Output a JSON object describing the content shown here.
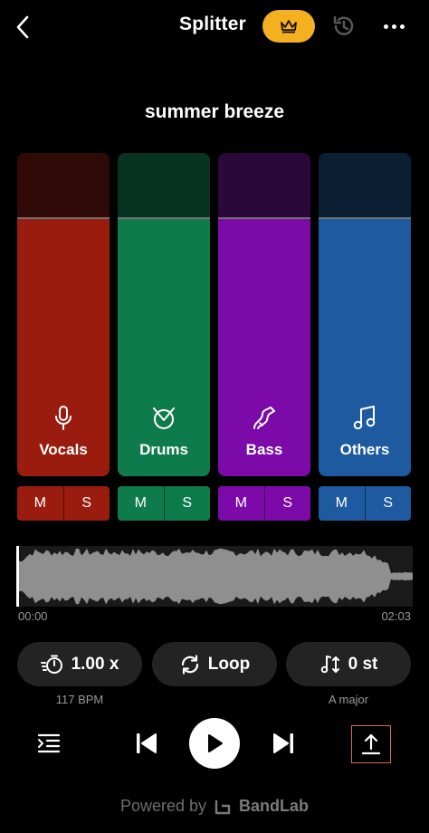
{
  "header": {
    "title": "Splitter",
    "back_icon": "chevron-left-icon",
    "premium_icon": "crown-icon",
    "history_icon": "history-icon",
    "more_icon": "more-dots-icon",
    "accent_color": "#f5b020"
  },
  "song": {
    "title": "summer breeze"
  },
  "stems": [
    {
      "label": "Vocals",
      "icon": "microphone-icon",
      "color": "#9a1c0e",
      "top_color": "#2f0a06",
      "mute": "M",
      "solo": "S"
    },
    {
      "label": "Drums",
      "icon": "drum-icon",
      "color": "#0e7b4c",
      "top_color": "#063322",
      "mute": "M",
      "solo": "S"
    },
    {
      "label": "Bass",
      "icon": "guitar-icon",
      "color": "#7b0aa9",
      "top_color": "#2a0839",
      "mute": "M",
      "solo": "S"
    },
    {
      "label": "Others",
      "icon": "music-note-icon",
      "color": "#1e5aa0",
      "top_color": "#0a1f33",
      "mute": "M",
      "solo": "S"
    }
  ],
  "timeline": {
    "start": "00:00",
    "end": "02:03"
  },
  "controls": {
    "speed": {
      "label": "1.00 x",
      "sub": "117 BPM",
      "icon": "tempo-icon"
    },
    "loop": {
      "label": "Loop",
      "icon": "loop-icon"
    },
    "pitch": {
      "label": "0 st",
      "sub": "A major",
      "icon": "pitch-icon"
    }
  },
  "transport": {
    "list_icon": "track-list-icon",
    "prev_icon": "skip-previous-icon",
    "play_icon": "play-icon",
    "next_icon": "skip-next-icon",
    "export_icon": "export-icon"
  },
  "footer": {
    "powered_by": "Powered by",
    "brand": "BandLab"
  }
}
